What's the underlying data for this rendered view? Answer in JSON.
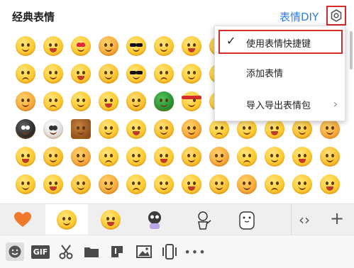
{
  "header": {
    "title": "经典表情",
    "diy_label": "表情DIY"
  },
  "menu": {
    "items": [
      {
        "label": "使用表情快捷键",
        "checked": true
      },
      {
        "label": "添加表情"
      },
      {
        "label": "导入导出表情包",
        "submenu": true
      }
    ]
  },
  "emoji_grid": {
    "rows": 6,
    "columns": 12
  },
  "category_tabs": [
    {
      "name": "heart-icon",
      "selected": false
    },
    {
      "name": "smile-face-icon",
      "selected": true
    },
    {
      "name": "grin-face-icon",
      "selected": false
    },
    {
      "name": "sticker-character-1",
      "selected": false
    },
    {
      "name": "sticker-character-2",
      "selected": false
    },
    {
      "name": "sticker-bear",
      "selected": false
    }
  ],
  "toolbar": {
    "items": [
      "emoji-icon",
      "GIF",
      "scissors-icon",
      "folder-icon",
      "sticker-icon",
      "image-icon",
      "phone-vibrate-icon",
      "more-icon"
    ],
    "gif_label": "GIF"
  },
  "colors": {
    "accent_blue": "#2d7ce3",
    "highlight_red": "#d62b2b",
    "heart_orange": "#f07a2a"
  }
}
